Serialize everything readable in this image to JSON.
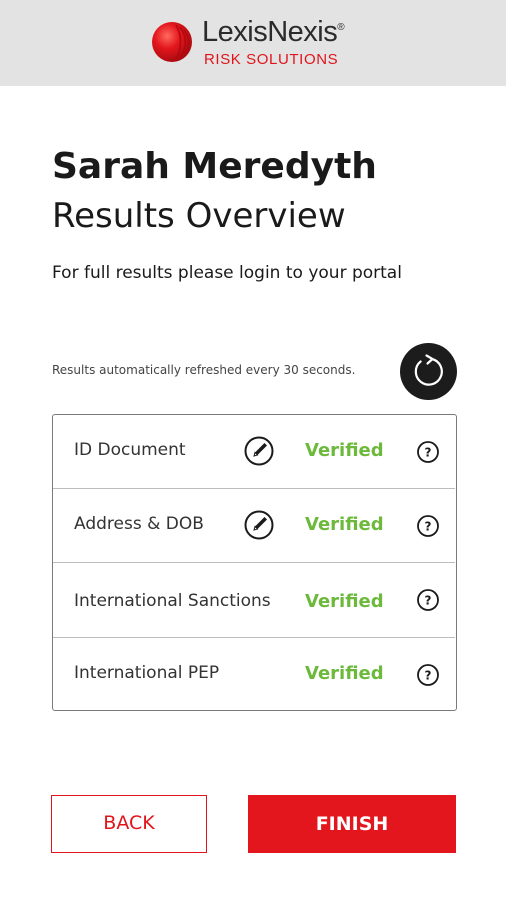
{
  "header": {
    "brand_name": "LexisNexis",
    "brand_mark": "®",
    "brand_sub": "RISK SOLUTIONS",
    "logo_icon": "red-sphere-logo-icon",
    "colors": {
      "brand_red": "#e0151c",
      "header_bg": "#e3e3e3"
    }
  },
  "main": {
    "name": "Sarah Meredyth",
    "subtitle": "Results Overview",
    "portal_note": "For full results please login to your portal",
    "refresh_note": "Results automatically refreshed every 30 seconds.",
    "refresh_icon": "refresh-icon"
  },
  "results": {
    "rows": [
      {
        "label": "ID Document",
        "status": "Verified",
        "has_edit": true
      },
      {
        "label": "Address & DOB",
        "status": "Verified",
        "has_edit": true
      },
      {
        "label": "International Sanctions",
        "status": "Verified",
        "has_edit": false
      },
      {
        "label": "International PEP",
        "status": "Verified",
        "has_edit": false
      }
    ],
    "status_color": "#6cb93b"
  },
  "actions": {
    "back_label": "BACK",
    "finish_label": "FINISH"
  }
}
